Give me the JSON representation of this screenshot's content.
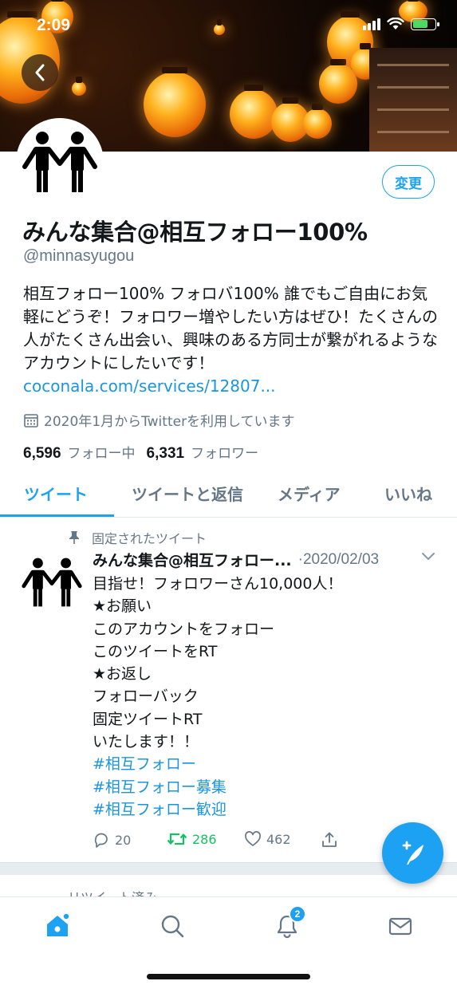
{
  "status_bar": {
    "time": "2:09"
  },
  "profile": {
    "edit_label": "変更",
    "display_name": "みんな集合@相互フォロー100%",
    "handle": "@minnasyugou",
    "bio_text": "相互フォロー100% フォロバ100% 誰でもご自由にお気軽にどうぞ！フォロワー増やしたい方はぜひ！たくさんの人がたくさん出会い、興味のある方同士が繋がれるようなアカウントにしたいです！",
    "bio_link": "coconala.com/services/12807...",
    "joined": "2020年1月からTwitterを利用しています",
    "following_count": "6,596",
    "following_label": "フォロー中",
    "followers_count": "6,331",
    "followers_label": "フォロワー"
  },
  "tabs": [
    {
      "label": "ツイート",
      "active": true
    },
    {
      "label": "ツイートと返信",
      "active": false
    },
    {
      "label": "メディア",
      "active": false
    },
    {
      "label": "いいね",
      "active": false
    }
  ],
  "tweet": {
    "pinned_label": "固定されたツイート",
    "author_name": "みんな集合@相互フォロー...",
    "date": "·2020/02/03",
    "lines": [
      "目指せ！フォロワーさん10,000人！",
      "★お願い",
      "このアカウントをフォロー",
      "このツイートをRT",
      "★お返し",
      "フォローバック",
      "固定ツイートRT",
      "いたします！！"
    ],
    "hashtags": [
      "#相互フォロー",
      "#相互フォロー募集",
      "#相互フォロー歓迎"
    ],
    "reply_count": "20",
    "retweet_count": "286",
    "like_count": "462"
  },
  "next_tweet": {
    "retweeted_label": "リツイート済み"
  },
  "nav": {
    "notification_badge": "2"
  },
  "colors": {
    "accent": "#1da1f2",
    "retweet_green": "#17bf63",
    "secondary_text": "#657786"
  }
}
